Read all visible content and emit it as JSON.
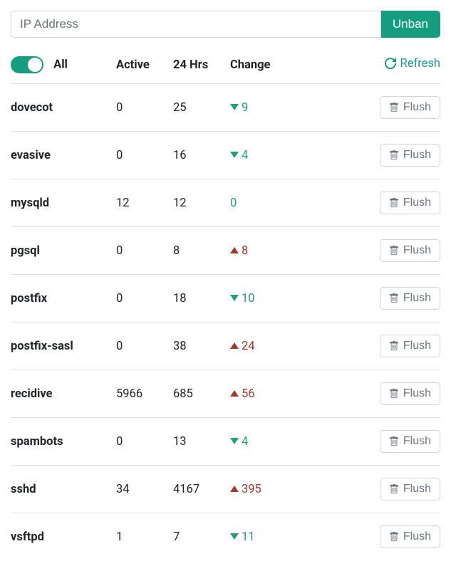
{
  "input": {
    "placeholder": "IP Address",
    "value": ""
  },
  "buttons": {
    "unban": "Unban",
    "refresh": "Refresh",
    "flush": "Flush"
  },
  "headers": {
    "all": "All",
    "active": "Active",
    "h24": "24 Hrs",
    "change": "Change"
  },
  "toggle_on": true,
  "rows": [
    {
      "name": "dovecot",
      "active": "0",
      "h24": "25",
      "change_dir": "down",
      "change_val": "9"
    },
    {
      "name": "evasive",
      "active": "0",
      "h24": "16",
      "change_dir": "down",
      "change_val": "4"
    },
    {
      "name": "mysqld",
      "active": "12",
      "h24": "12",
      "change_dir": "zero",
      "change_val": "0"
    },
    {
      "name": "pgsql",
      "active": "0",
      "h24": "8",
      "change_dir": "up",
      "change_val": "8"
    },
    {
      "name": "postfix",
      "active": "0",
      "h24": "18",
      "change_dir": "down",
      "change_val": "10"
    },
    {
      "name": "postfix-sasl",
      "active": "0",
      "h24": "38",
      "change_dir": "up",
      "change_val": "24"
    },
    {
      "name": "recidive",
      "active": "5966",
      "h24": "685",
      "change_dir": "up",
      "change_val": "56"
    },
    {
      "name": "spambots",
      "active": "0",
      "h24": "13",
      "change_dir": "down",
      "change_val": "4"
    },
    {
      "name": "sshd",
      "active": "34",
      "h24": "4167",
      "change_dir": "up",
      "change_val": "395"
    },
    {
      "name": "vsftpd",
      "active": "1",
      "h24": "7",
      "change_dir": "down",
      "change_val": "11"
    }
  ]
}
